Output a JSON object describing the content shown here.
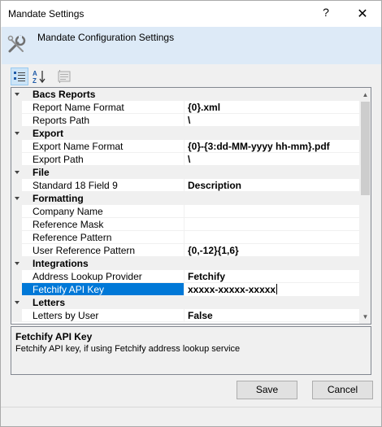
{
  "window": {
    "title": "Mandate Settings",
    "help_glyph": "?",
    "close_glyph": "✕"
  },
  "header": {
    "text": "Mandate Configuration Settings",
    "icon": "wrench-settings-icon"
  },
  "toolbar": {
    "categorized_icon": "categorized-icon",
    "alphabetical_icon": "alphabetical-sort-icon",
    "property_pages_icon": "property-pages-icon"
  },
  "grid": {
    "rows": [
      {
        "type": "category",
        "label": "Bacs Reports"
      },
      {
        "type": "property",
        "name": "Report Name Format",
        "value": "{0}.xml"
      },
      {
        "type": "property",
        "name": "Reports Path",
        "value": "\\"
      },
      {
        "type": "category",
        "label": "Export"
      },
      {
        "type": "property",
        "name": "Export Name Format",
        "value": "{0}-{3:dd-MM-yyyy hh-mm}.pdf"
      },
      {
        "type": "property",
        "name": "Export Path",
        "value": "\\"
      },
      {
        "type": "category",
        "label": "File"
      },
      {
        "type": "property",
        "name": "Standard 18 Field 9",
        "value": "Description"
      },
      {
        "type": "category",
        "label": "Formatting"
      },
      {
        "type": "property",
        "name": "Company Name",
        "value": ""
      },
      {
        "type": "property",
        "name": "Reference Mask",
        "value": ""
      },
      {
        "type": "property",
        "name": "Reference Pattern",
        "value": ""
      },
      {
        "type": "property",
        "name": "User Reference Pattern",
        "value": "{0,-12}{1,6}"
      },
      {
        "type": "category",
        "label": "Integrations"
      },
      {
        "type": "property",
        "name": "Address Lookup Provider",
        "value": "Fetchify"
      },
      {
        "type": "property",
        "name": "Fetchify API Key",
        "value": "xxxxx-xxxxx-xxxxx",
        "selected": true
      },
      {
        "type": "category",
        "label": "Letters"
      },
      {
        "type": "property",
        "name": "Letters by User",
        "value": "False"
      }
    ]
  },
  "description": {
    "title": "Fetchify API Key",
    "text": "Fetchify API key, if using Fetchify address lookup service"
  },
  "buttons": {
    "save": "Save",
    "cancel": "Cancel"
  },
  "colors": {
    "selection": "#0078d7",
    "header_band": "#ddeaf7"
  }
}
